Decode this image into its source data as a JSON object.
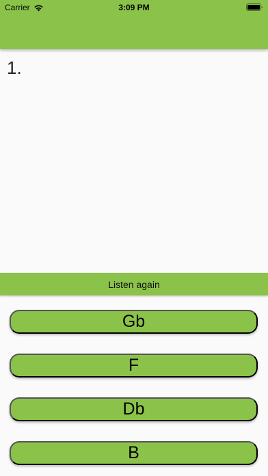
{
  "status_bar": {
    "carrier": "Carrier",
    "time": "3:09 PM",
    "icons": [
      "wifi-icon",
      "battery-icon"
    ]
  },
  "colors": {
    "accent": "#8bc34a",
    "background": "#fafafa"
  },
  "question": {
    "number": "1."
  },
  "listen_button": {
    "label": "Listen again"
  },
  "answers": [
    {
      "label": "Gb"
    },
    {
      "label": "F"
    },
    {
      "label": "Db"
    },
    {
      "label": "B"
    }
  ]
}
